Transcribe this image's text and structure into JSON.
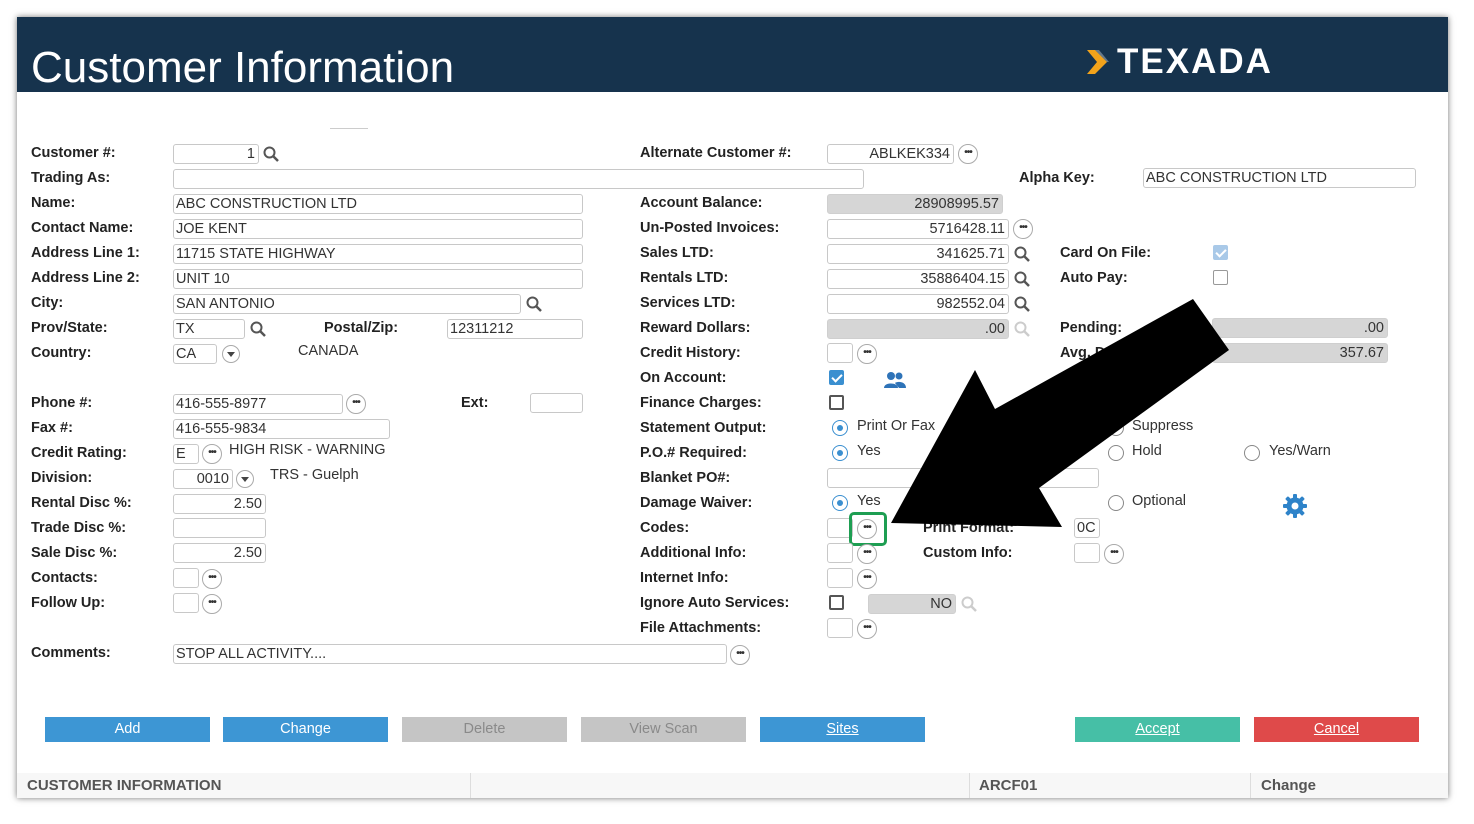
{
  "header": {
    "title": "Customer Information",
    "logo_text": "TEXADA"
  },
  "left": {
    "customer_no_label": "Customer #:",
    "customer_no": "1",
    "trading_as_label": "Trading As:",
    "trading_as": "",
    "name_label": "Name:",
    "name": "ABC CONSTRUCTION LTD",
    "contact_label": "Contact Name:",
    "contact": "JOE KENT",
    "addr1_label": "Address Line 1:",
    "addr1": "11715 STATE HIGHWAY",
    "addr2_label": "Address Line 2:",
    "addr2": "UNIT 10",
    "city_label": "City:",
    "city": "SAN ANTONIO",
    "prov_label": "Prov/State:",
    "prov": "TX",
    "postal_label": "Postal/Zip:",
    "postal": "12311212",
    "country_label": "Country:",
    "country": "CA",
    "country_name": "CANADA",
    "phone_label": "Phone #:",
    "phone": "416-555-8977",
    "ext_label": "Ext:",
    "ext": "",
    "fax_label": "Fax #:",
    "fax": "416-555-9834",
    "credit_rating_label": "Credit Rating:",
    "credit_rating": "E",
    "credit_rating_desc": "HIGH RISK - WARNING",
    "division_label": "Division:",
    "division": "0010",
    "division_desc": "TRS - Guelph",
    "rental_disc_label": "Rental Disc %:",
    "rental_disc": "2.50",
    "trade_disc_label": "Trade Disc %:",
    "trade_disc": "",
    "sale_disc_label": "Sale Disc %:",
    "sale_disc": "2.50",
    "contacts_label": "Contacts:",
    "follow_up_label": "Follow Up:",
    "comments_label": "Comments:",
    "comments": "STOP ALL ACTIVITY...."
  },
  "middle": {
    "alt_customer_label": "Alternate Customer #:",
    "alt_customer": "ABLKEK334",
    "account_balance_label": "Account Balance:",
    "account_balance": "28908995.57",
    "unposted_label": "Un-Posted Invoices:",
    "unposted": "5716428.11",
    "sales_ltd_label": "Sales LTD:",
    "sales_ltd": "341625.71",
    "rentals_ltd_label": "Rentals LTD:",
    "rentals_ltd": "35886404.15",
    "services_ltd_label": "Services LTD:",
    "services_ltd": "982552.04",
    "reward_label": "Reward Dollars:",
    "reward": ".00",
    "credit_history_label": "Credit History:",
    "on_account_label": "On Account:",
    "finance_label": "Finance Charges:",
    "statement_label": "Statement Output:",
    "statement_opt1": "Print Or Fax",
    "statement_opt2": "Suppress",
    "po_label": "P.O.# Required:",
    "po_opt1": "Yes",
    "po_opt2": "Hold",
    "po_opt3": "Yes/Warn",
    "blanket_label": "Blanket PO#:",
    "damage_label": "Damage Waiver:",
    "damage_opt1": "Yes",
    "damage_opt2": "Optional",
    "codes_label": "Codes:",
    "print_format_label": "Print Format:",
    "print_format": "0C",
    "additional_label": "Additional Info:",
    "custom_label": "Custom Info:",
    "internet_label": "Internet Info:",
    "ignore_label": "Ignore Auto Services:",
    "ignore_value": "NO",
    "file_attach_label": "File Attachments:"
  },
  "right": {
    "alpha_key_label": "Alpha Key:",
    "alpha_key": "ABC CONSTRUCTION LTD",
    "card_on_file_label": "Card On File:",
    "auto_pay_label": "Auto Pay:",
    "pending_label": "Pending:",
    "pending": ".00",
    "avg_label": "Avg. Days:",
    "avg": "357.67"
  },
  "buttons": {
    "add": "Add",
    "change": "Change",
    "delete": "Delete",
    "view_scan": "View Scan",
    "sites": "Sites",
    "accept": "Accept",
    "cancel": "Cancel"
  },
  "status": {
    "screen": "CUSTOMER INFORMATION",
    "code": "ARCF01",
    "mode": "Change"
  },
  "colors": {
    "header_bg": "#16334d",
    "accent_blue": "#3d96d4",
    "accept_green": "#46bfa6",
    "cancel_red": "#df4a4a",
    "highlight_green": "#1e9e52"
  }
}
